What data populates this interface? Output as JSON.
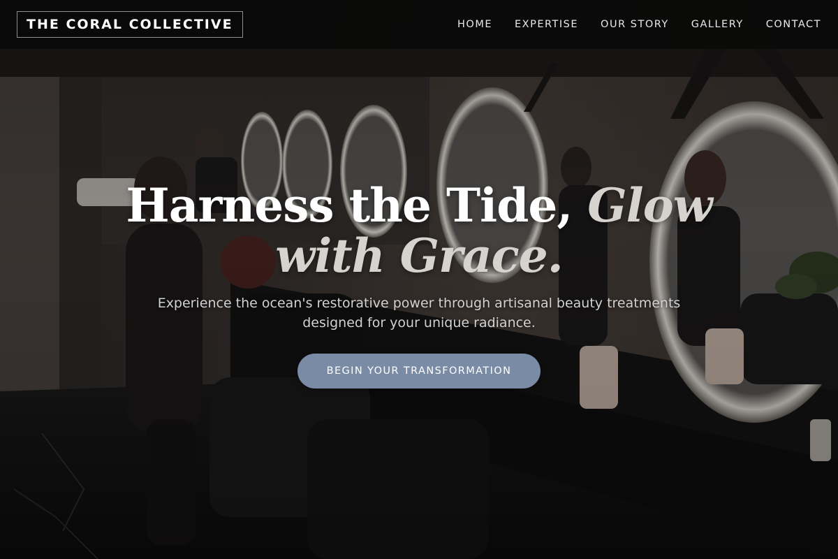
{
  "nav": {
    "brand": "THE CORAL COLLECTIVE",
    "links": [
      {
        "label": "HOME"
      },
      {
        "label": "EXPERTISE"
      },
      {
        "label": "OUR STORY"
      },
      {
        "label": "GALLERY"
      },
      {
        "label": "CONTACT"
      }
    ]
  },
  "hero": {
    "title_main": "Harness the Tide, ",
    "title_accent_1": "Glow",
    "title_accent_2": "with Grace.",
    "subtitle": "Experience the ocean's restorative power through artisanal beauty treatments designed for your unique radiance.",
    "cta_label": "BEGIN YOUR TRANSFORMATION"
  },
  "colors": {
    "nav_background": "#080808",
    "cta_background": "#7a8ba5",
    "title_text": "#ffffff",
    "title_accent": "#d6d3cf",
    "subtitle_text": "#d2d2d2"
  }
}
